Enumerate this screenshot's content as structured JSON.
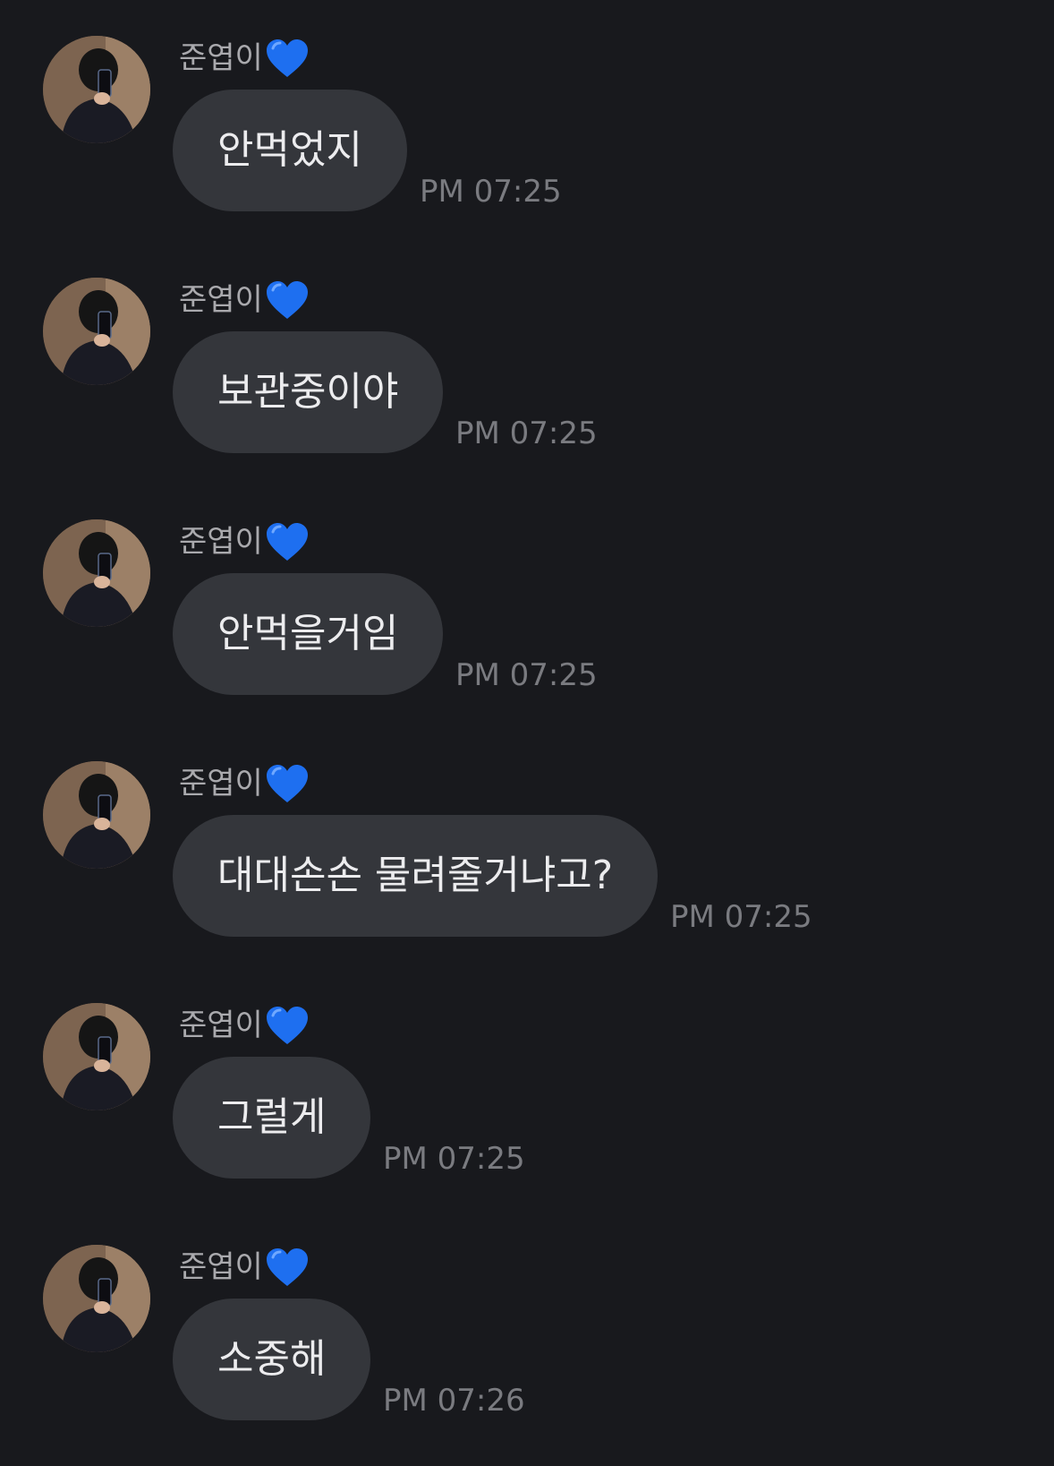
{
  "messages": [
    {
      "sender": "준엽이",
      "text": "안먹었지",
      "time": "PM 07:25"
    },
    {
      "sender": "준엽이",
      "text": "보관중이야",
      "time": "PM 07:25"
    },
    {
      "sender": "준엽이",
      "text": "안먹을거임",
      "time": "PM 07:25"
    },
    {
      "sender": "준엽이",
      "text": "대대손손 물려줄거냐고?",
      "time": "PM 07:25"
    },
    {
      "sender": "준엽이",
      "text": "그럴게",
      "time": "PM 07:25"
    },
    {
      "sender": "준엽이",
      "text": "소중해",
      "time": "PM 07:26"
    }
  ],
  "colors": {
    "background": "#18191d",
    "bubble": "#34363b",
    "bubble_text": "#ececee",
    "sender_text": "#a9a9ad",
    "time_text": "#7a7b80",
    "heart": "#1e6ff0"
  },
  "icons": {
    "sender_badge": "blue-heart-icon",
    "avatar": "profile-photo"
  }
}
